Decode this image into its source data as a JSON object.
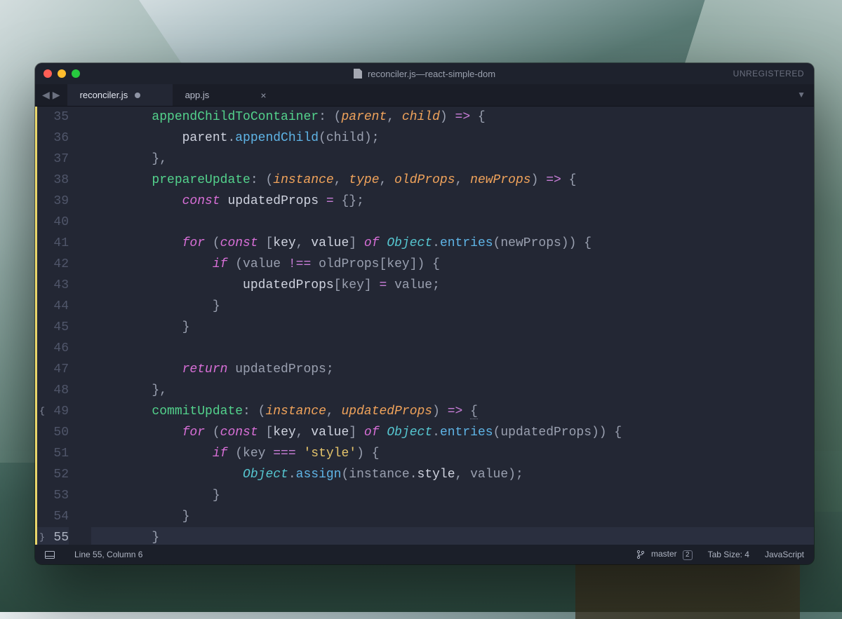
{
  "titlebar": {
    "filename": "reconciler.js",
    "project": "react-simple-dom",
    "separator": " — ",
    "unregistered": "UNREGISTERED"
  },
  "tabs": [
    {
      "label": "reconciler.js",
      "active": true,
      "dirty": true,
      "closeable": false
    },
    {
      "label": "app.js",
      "active": false,
      "dirty": false,
      "closeable": true
    }
  ],
  "gutter": {
    "start": 35,
    "end": 55,
    "current_line": 55,
    "modified_lines": [
      35,
      36,
      37,
      38,
      39,
      40,
      41,
      42,
      43,
      44,
      45,
      46,
      47,
      48,
      49,
      50,
      51,
      52,
      53,
      54,
      55
    ],
    "open_brace_marker_line": 49,
    "close_brace_marker_line": 55
  },
  "code_lines": [
    {
      "n": 35,
      "indent": 2,
      "tokens": [
        [
          "fn",
          "appendChildToContainer"
        ],
        [
          "punct",
          ": ("
        ],
        [
          "param",
          "parent"
        ],
        [
          "punct",
          ", "
        ],
        [
          "param",
          "child"
        ],
        [
          "punct",
          ") "
        ],
        [
          "op",
          "=>"
        ],
        [
          "punct",
          " {"
        ]
      ]
    },
    {
      "n": 36,
      "indent": 3,
      "tokens": [
        [
          "var",
          "parent"
        ],
        [
          "punct",
          "."
        ],
        [
          "call",
          "appendChild"
        ],
        [
          "punct",
          "(child);"
        ]
      ]
    },
    {
      "n": 37,
      "indent": 2,
      "tokens": [
        [
          "punct",
          "},"
        ]
      ]
    },
    {
      "n": 38,
      "indent": 2,
      "tokens": [
        [
          "fn",
          "prepareUpdate"
        ],
        [
          "punct",
          ": ("
        ],
        [
          "param",
          "instance"
        ],
        [
          "punct",
          ", "
        ],
        [
          "param",
          "type"
        ],
        [
          "punct",
          ", "
        ],
        [
          "param",
          "oldProps"
        ],
        [
          "punct",
          ", "
        ],
        [
          "param",
          "newProps"
        ],
        [
          "punct",
          ") "
        ],
        [
          "op",
          "=>"
        ],
        [
          "punct",
          " {"
        ]
      ]
    },
    {
      "n": 39,
      "indent": 3,
      "tokens": [
        [
          "const",
          "const"
        ],
        [
          "punct",
          " "
        ],
        [
          "var",
          "updatedProps"
        ],
        [
          "punct",
          " "
        ],
        [
          "op",
          "="
        ],
        [
          "punct",
          " {};"
        ]
      ]
    },
    {
      "n": 40,
      "indent": 0,
      "tokens": []
    },
    {
      "n": 41,
      "indent": 3,
      "tokens": [
        [
          "kw",
          "for"
        ],
        [
          "punct",
          " ("
        ],
        [
          "const",
          "const"
        ],
        [
          "punct",
          " ["
        ],
        [
          "var",
          "key"
        ],
        [
          "punct",
          ", "
        ],
        [
          "var",
          "value"
        ],
        [
          "punct",
          "] "
        ],
        [
          "kw",
          "of"
        ],
        [
          "punct",
          " "
        ],
        [
          "obj",
          "Object"
        ],
        [
          "punct",
          "."
        ],
        [
          "call",
          "entries"
        ],
        [
          "punct",
          "(newProps)) {"
        ]
      ]
    },
    {
      "n": 42,
      "indent": 4,
      "tokens": [
        [
          "kw",
          "if"
        ],
        [
          "punct",
          " (value "
        ],
        [
          "op",
          "!=="
        ],
        [
          "punct",
          " oldProps[key]) {"
        ]
      ]
    },
    {
      "n": 43,
      "indent": 5,
      "tokens": [
        [
          "var",
          "updatedProps"
        ],
        [
          "punct",
          "[key] "
        ],
        [
          "op",
          "="
        ],
        [
          "punct",
          " value;"
        ]
      ]
    },
    {
      "n": 44,
      "indent": 4,
      "tokens": [
        [
          "punct",
          "}"
        ]
      ]
    },
    {
      "n": 45,
      "indent": 3,
      "tokens": [
        [
          "punct",
          "}"
        ]
      ]
    },
    {
      "n": 46,
      "indent": 0,
      "tokens": []
    },
    {
      "n": 47,
      "indent": 3,
      "tokens": [
        [
          "kw",
          "return"
        ],
        [
          "punct",
          " updatedProps;"
        ]
      ]
    },
    {
      "n": 48,
      "indent": 2,
      "tokens": [
        [
          "punct",
          "},"
        ]
      ]
    },
    {
      "n": 49,
      "indent": 2,
      "tokens": [
        [
          "fn",
          "commitUpdate"
        ],
        [
          "punct",
          ": ("
        ],
        [
          "param",
          "instance"
        ],
        [
          "punct",
          ", "
        ],
        [
          "param",
          "updatedProps"
        ],
        [
          "punct",
          ") "
        ],
        [
          "op",
          "=>"
        ],
        [
          "punct",
          " "
        ],
        [
          "punct underline",
          "{"
        ]
      ]
    },
    {
      "n": 50,
      "indent": 3,
      "tokens": [
        [
          "kw",
          "for"
        ],
        [
          "punct",
          " ("
        ],
        [
          "const",
          "const"
        ],
        [
          "punct",
          " ["
        ],
        [
          "var",
          "key"
        ],
        [
          "punct",
          ", "
        ],
        [
          "var",
          "value"
        ],
        [
          "punct",
          "] "
        ],
        [
          "kw",
          "of"
        ],
        [
          "punct",
          " "
        ],
        [
          "obj",
          "Object"
        ],
        [
          "punct",
          "."
        ],
        [
          "call",
          "entries"
        ],
        [
          "punct",
          "(updatedProps)) {"
        ]
      ]
    },
    {
      "n": 51,
      "indent": 4,
      "tokens": [
        [
          "kw",
          "if"
        ],
        [
          "punct",
          " (key "
        ],
        [
          "op",
          "==="
        ],
        [
          "punct",
          " "
        ],
        [
          "str",
          "'style'"
        ],
        [
          "punct",
          ") {"
        ]
      ]
    },
    {
      "n": 52,
      "indent": 5,
      "tokens": [
        [
          "obj",
          "Object"
        ],
        [
          "punct",
          "."
        ],
        [
          "call",
          "assign"
        ],
        [
          "punct",
          "(instance."
        ],
        [
          "var",
          "style"
        ],
        [
          "punct",
          ", value);"
        ]
      ]
    },
    {
      "n": 53,
      "indent": 4,
      "tokens": [
        [
          "punct",
          "}"
        ]
      ]
    },
    {
      "n": 54,
      "indent": 3,
      "tokens": [
        [
          "punct",
          "}"
        ]
      ]
    },
    {
      "n": 55,
      "indent": 2,
      "current": true,
      "tokens": [
        [
          "punct underline",
          "}"
        ]
      ]
    }
  ],
  "statusbar": {
    "cursor": "Line 55, Column 6",
    "branch": "master",
    "branch_badge": "2",
    "tab_size": "Tab Size: 4",
    "language": "JavaScript"
  }
}
